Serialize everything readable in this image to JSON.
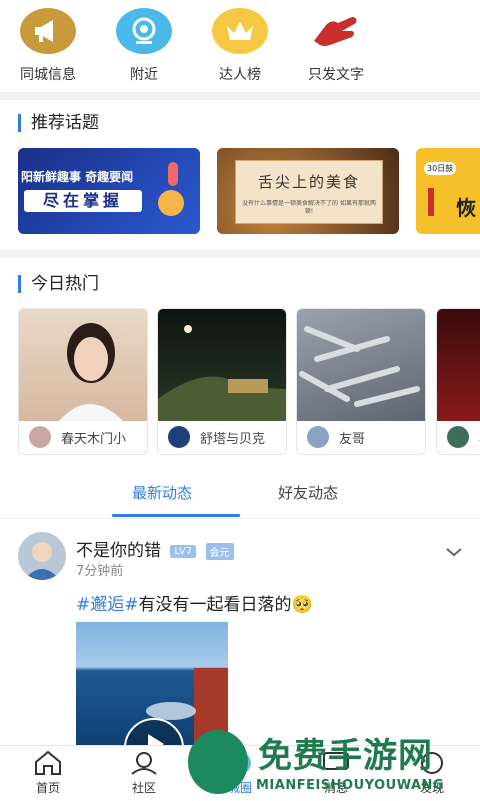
{
  "top_nav": [
    {
      "label": "同城信息",
      "icon": "megaphone-icon",
      "color": "#c99a3b"
    },
    {
      "label": "附近",
      "icon": "location-icon",
      "color": "#4ab8e8"
    },
    {
      "label": "达人榜",
      "icon": "crown-icon",
      "color": "#f7c843"
    },
    {
      "label": "只发文字",
      "icon": "hand-icon",
      "color": "#c9302c"
    }
  ],
  "recommended": {
    "title": "推荐话题",
    "cards": [
      {
        "line1": "阳新鲜趣事 奇趣要闻",
        "line2": "尽在掌握"
      },
      {
        "line1": "舌尖上的美食",
        "line2": "没有什么事情是一顿美食解决不了的 如果有那就两顿!"
      },
      {
        "line1": "30日鼓",
        "line2": "恢"
      }
    ]
  },
  "hot_today": {
    "title": "今日热门",
    "cards": [
      {
        "user": "春天木门小"
      },
      {
        "user": "舒塔与贝克"
      },
      {
        "user": "友哥"
      },
      {
        "user": "看"
      }
    ]
  },
  "tabs": {
    "latest": "最新动态",
    "friends": "好友动态"
  },
  "post": {
    "username": "不是你的错",
    "level": "LV7",
    "member": "会元",
    "time": "7分钟前",
    "hashtag": "#邂逅#",
    "text": "有没有一起看日落的",
    "emoji": "🥺"
  },
  "bottom_nav": [
    {
      "label": "首页",
      "icon": "home-icon"
    },
    {
      "label": "社区",
      "icon": "community-icon"
    },
    {
      "label": "城圈",
      "icon": "city-icon"
    },
    {
      "label": "消息",
      "icon": "message-icon"
    },
    {
      "label": "发现",
      "icon": "discover-icon"
    }
  ],
  "watermark": {
    "title": "免费手游网",
    "url": "MIANFEISHOUYOUWANG"
  }
}
